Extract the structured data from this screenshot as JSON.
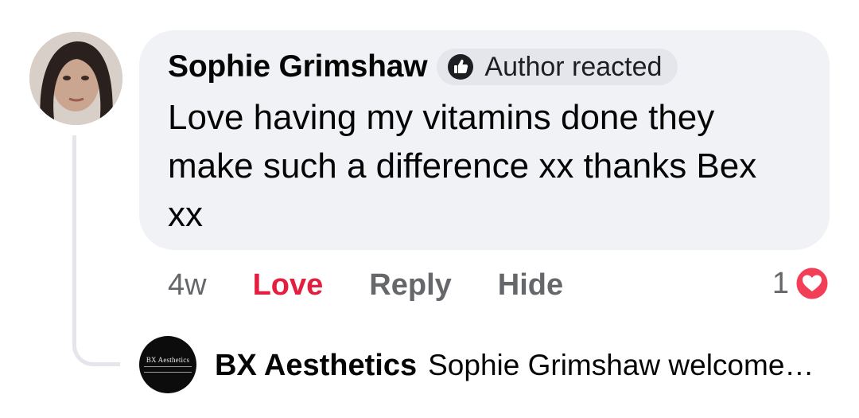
{
  "comment": {
    "author": "Sophie Grimshaw",
    "badge": {
      "icon": "thumbs-up-icon",
      "label": "Author reacted"
    },
    "text": "Love having my vitamins done they make such a difference xx thanks Bex xx"
  },
  "actions": {
    "time": "4w",
    "love_label": "Love",
    "reply_label": "Reply",
    "hide_label": "Hide"
  },
  "reactions": {
    "count": "1",
    "icon": "heart-icon"
  },
  "reply_preview": {
    "author": "BX Aesthetics",
    "avatar_logo": "BX Aesthetics",
    "text": "Sophie Grimshaw welcome…"
  },
  "colors": {
    "bubble": "#f0f2f5",
    "love": "#e41e3f",
    "muted": "#65676b",
    "badge_bg": "#e4e6eb"
  }
}
